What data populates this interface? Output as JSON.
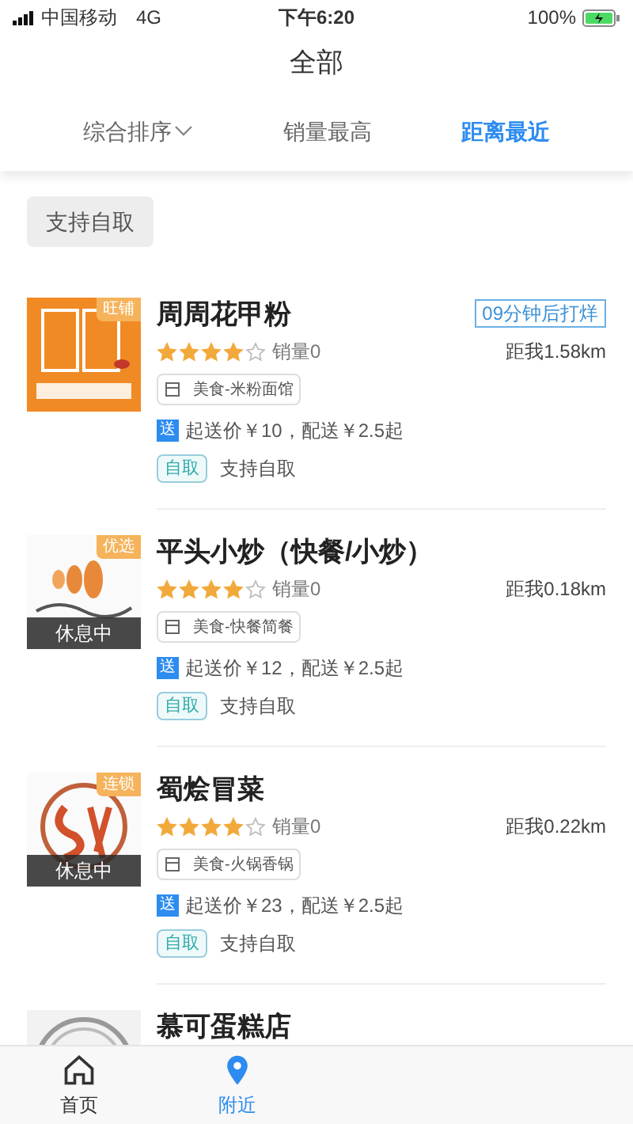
{
  "status_bar": {
    "carrier": "中国移动",
    "network": "4G",
    "time": "下午6:20",
    "battery": "100%",
    "charging": true
  },
  "title": "全部",
  "sort_tabs": [
    {
      "label": "综合排序",
      "selected": false,
      "kind": "dropdown"
    },
    {
      "label": "销量最高",
      "selected": false,
      "kind": "plain"
    },
    {
      "label": "距离最近",
      "selected": true,
      "kind": "plain"
    }
  ],
  "filter_chip": "支持自取",
  "shops": [
    {
      "name": "周周花甲粉",
      "badge": "旺铺",
      "status_tag": "09分钟后打烊",
      "stars": 4,
      "sales": "销量0",
      "distance": "距我1.58km",
      "category": "美食-米粉面馆",
      "delivery_tag": "送",
      "delivery": "起送价￥10，配送￥2.5起",
      "pickup_tag": "自取",
      "pickup": "支持自取"
    },
    {
      "name": "平头小炒（快餐/小炒）",
      "badge": "优选",
      "resting_label": "休息中",
      "stars": 4,
      "sales": "销量0",
      "distance": "距我0.18km",
      "category": "美食-快餐简餐",
      "delivery_tag": "送",
      "delivery": "起送价￥12，配送￥2.5起",
      "pickup_tag": "自取",
      "pickup": "支持自取"
    },
    {
      "name": "蜀烩冒菜",
      "badge": "连锁",
      "resting_label": "休息中",
      "stars": 4,
      "sales": "销量0",
      "distance": "距我0.22km",
      "category": "美食-火锅香锅",
      "delivery_tag": "送",
      "delivery": "起送价￥23，配送￥2.5起",
      "pickup_tag": "自取",
      "pickup": "支持自取"
    },
    {
      "name": "慕可蛋糕店"
    }
  ],
  "tab_bar": [
    {
      "label": "首页",
      "kind": "home",
      "selected": false
    },
    {
      "label": "附近",
      "kind": "pin",
      "selected": true
    }
  ]
}
